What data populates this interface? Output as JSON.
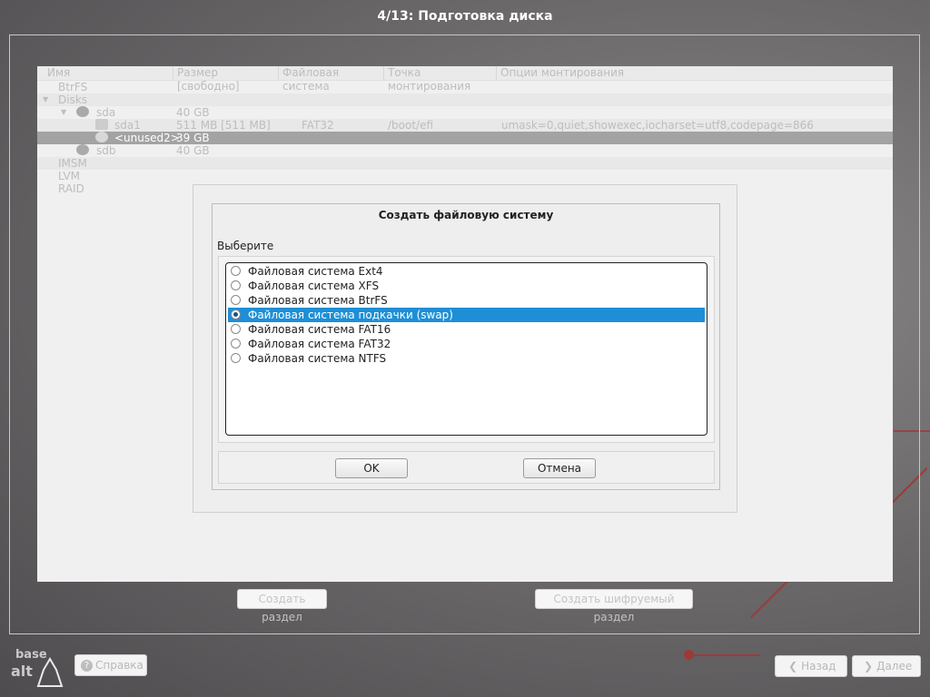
{
  "window": {
    "title": "4/13: Подготовка диска"
  },
  "table": {
    "columns": [
      "Имя",
      "Размер [свободно]",
      "Файловая система",
      "Точка монтирования",
      "Опции монтирования"
    ],
    "rows": [
      {
        "name": "BtrFS",
        "size": "",
        "fs": "",
        "mount": "",
        "opts": ""
      },
      {
        "name": "Disks",
        "size": "",
        "fs": "",
        "mount": "",
        "opts": ""
      },
      {
        "name": "sda",
        "size": "40 GB",
        "fs": "",
        "mount": "",
        "opts": ""
      },
      {
        "name": "sda1",
        "size": "511 MB [511 MB]",
        "fs": "FAT32",
        "mount": "/boot/efi",
        "opts": "umask=0,quiet,showexec,iocharset=utf8,codepage=866"
      },
      {
        "name": "<unused2>",
        "size": "39 GB",
        "fs": "",
        "mount": "",
        "opts": ""
      },
      {
        "name": "sdb",
        "size": "40 GB",
        "fs": "",
        "mount": "",
        "opts": ""
      },
      {
        "name": "IMSM",
        "size": "",
        "fs": "",
        "mount": "",
        "opts": ""
      },
      {
        "name": "LVM",
        "size": "",
        "fs": "",
        "mount": "",
        "opts": ""
      },
      {
        "name": "RAID",
        "size": "",
        "fs": "",
        "mount": "",
        "opts": ""
      }
    ]
  },
  "dialog": {
    "title": "Создать файловую систему",
    "prompt": "Выберите",
    "options": [
      "Файловая система Ext4",
      "Файловая система XFS",
      "Файловая система BtrFS",
      "Файловая система подкачки (swap)",
      "Файловая система FAT16",
      "Файловая система FAT32",
      "Файловая система NTFS"
    ],
    "selected": "Файловая система подкачки (swap)",
    "ok": "OK",
    "cancel": "Отмена"
  },
  "actions": {
    "create_partition": "Создать раздел",
    "create_encrypted": "Создать шифруемый раздел"
  },
  "footer": {
    "help": "Справка",
    "back": "Назад",
    "next": "Далее",
    "logo_top": "base",
    "logo_bottom": "alt"
  },
  "colors": {
    "selection": "#1e8fd6",
    "accent_line": "#9c3a3a"
  }
}
